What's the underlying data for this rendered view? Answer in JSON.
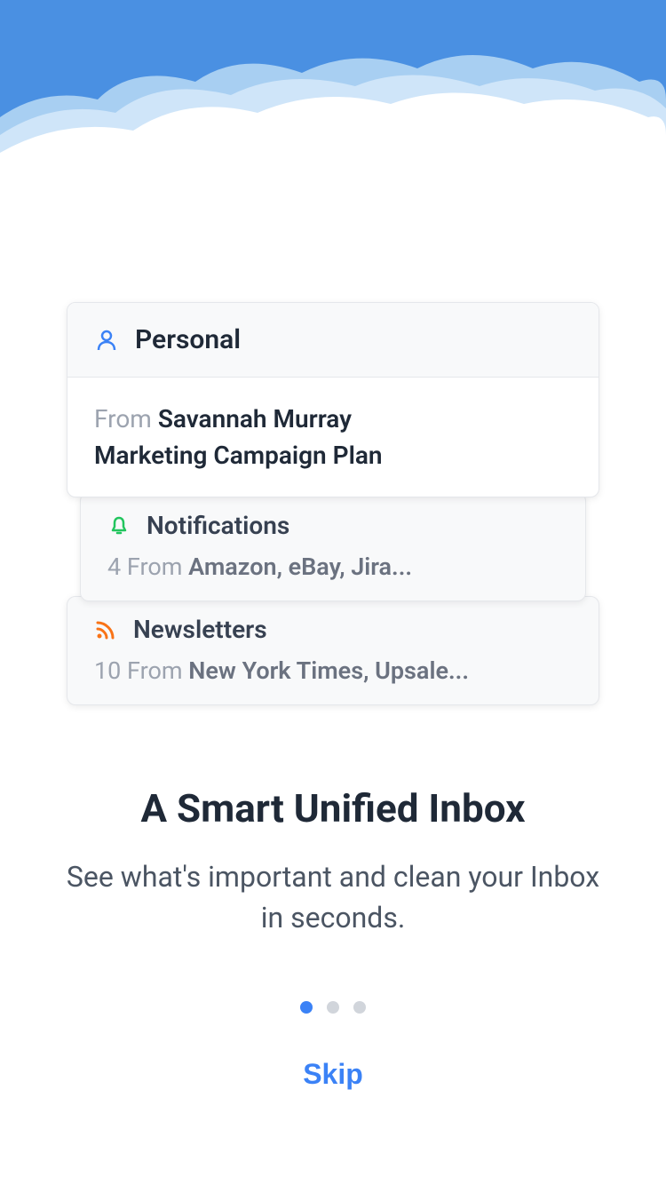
{
  "cards": {
    "personal": {
      "title": "Personal",
      "from_label": "From ",
      "sender": "Savannah Murray",
      "subject": "Marketing Campaign Plan"
    },
    "notifications": {
      "title": "Notifications",
      "count_prefix": "4 From ",
      "sources": "Amazon, eBay, Jira..."
    },
    "newsletters": {
      "title": "Newsletters",
      "count_prefix": "10 From ",
      "sources": "New York Times, Upsale..."
    }
  },
  "headline": "A Smart Unified Inbox",
  "subheadline": "See what's important and clean your Inbox in seconds.",
  "skip_label": "Skip",
  "pagination": {
    "current": 0,
    "total": 3
  },
  "colors": {
    "accent_blue": "#3b82f6",
    "icon_green": "#22c55e",
    "icon_orange": "#f97316"
  }
}
